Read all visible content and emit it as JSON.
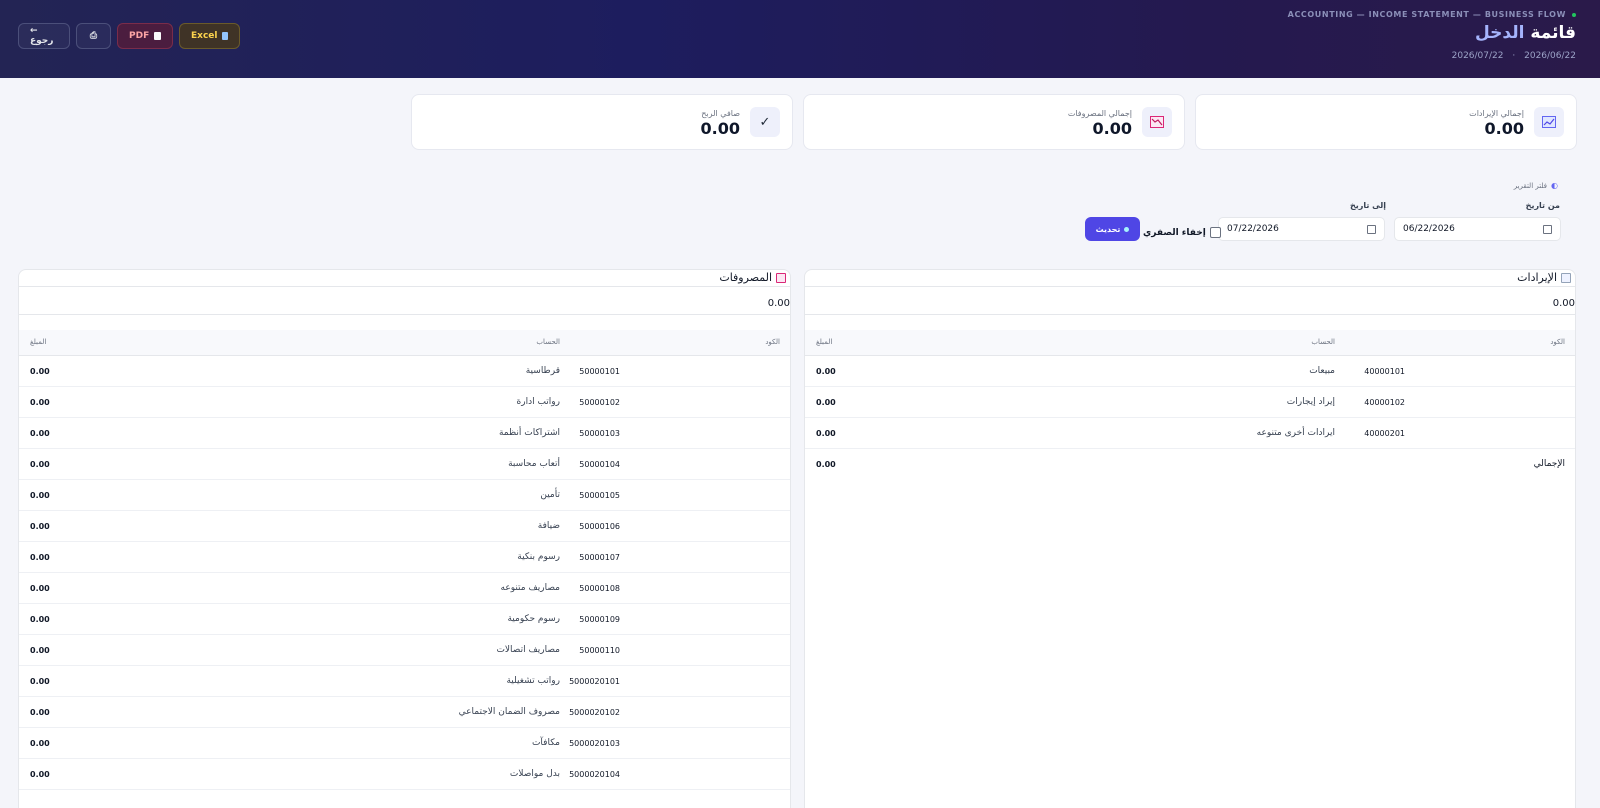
{
  "header": {
    "eyebrow": "ACCOUNTING — INCOME STATEMENT — BUSINESS FLOW",
    "title_plain": "قائمة",
    "title_accent": "الدخل",
    "date_from": "2026/06/22",
    "date_to": "2026/07/22",
    "date_sep": "·",
    "buttons": {
      "excel": "Excel",
      "pdf": "PDF",
      "print": "⎙",
      "back": "← رجوع"
    }
  },
  "summary": {
    "revenue": {
      "label": "إجمالي الإيرادات",
      "value": "0.00",
      "icon": "chart-up-icon"
    },
    "expenses": {
      "label": "إجمالي المصروفات",
      "value": "0.00",
      "icon": "chart-down-icon"
    },
    "net_profit": {
      "label": "صافي الربح",
      "value": "0.00",
      "icon": "check-icon"
    }
  },
  "filter": {
    "title": "فلتر التقرير",
    "from_label": "من تاريخ",
    "from_value": "06/22/2026",
    "to_label": "إلى تاريخ",
    "to_value": "07/22/2026",
    "hide_zero_label": "إخفاء الصفري",
    "hide_zero_checked": false,
    "update_label": "تحديث"
  },
  "revenues": {
    "title": "الإيرادات",
    "total": "0.00",
    "columns": {
      "code": "الكود",
      "account": "الحساب",
      "amount": "المبلغ"
    },
    "rows": [
      {
        "code": "40000101",
        "account": "مبيعات",
        "amount": "0.00"
      },
      {
        "code": "40000102",
        "account": "إيراد إيجارات",
        "amount": "0.00"
      },
      {
        "code": "40000201",
        "account": "ايرادات أخرى متنوعه",
        "amount": "0.00"
      }
    ],
    "total_label": "الإجمالي",
    "total_amount": "0.00"
  },
  "expenses": {
    "title": "المصروفات",
    "total": "0.00",
    "columns": {
      "code": "الكود",
      "account": "الحساب",
      "amount": "المبلغ"
    },
    "rows": [
      {
        "code": "50000101",
        "account": "قرطاسية",
        "amount": "0.00"
      },
      {
        "code": "50000102",
        "account": "رواتب ادارة",
        "amount": "0.00"
      },
      {
        "code": "50000103",
        "account": "اشتراكات أنظمة",
        "amount": "0.00"
      },
      {
        "code": "50000104",
        "account": "أتعاب محاسبة",
        "amount": "0.00"
      },
      {
        "code": "50000105",
        "account": "تأمين",
        "amount": "0.00"
      },
      {
        "code": "50000106",
        "account": "ضيافة",
        "amount": "0.00"
      },
      {
        "code": "50000107",
        "account": "رسوم بنكية",
        "amount": "0.00"
      },
      {
        "code": "50000108",
        "account": "مصاريف متنوعه",
        "amount": "0.00"
      },
      {
        "code": "50000109",
        "account": "رسوم حكومية",
        "amount": "0.00"
      },
      {
        "code": "50000110",
        "account": "مصاريف اتصالات",
        "amount": "0.00"
      },
      {
        "code": "5000020101",
        "account": "رواتب تشغيلية",
        "amount": "0.00"
      },
      {
        "code": "5000020102",
        "account": "مصروف الضمان الاجتماعي",
        "amount": "0.00"
      },
      {
        "code": "5000020103",
        "account": "مكافآت",
        "amount": "0.00"
      },
      {
        "code": "5000020104",
        "account": "بدل مواصلات",
        "amount": "0.00"
      }
    ]
  }
}
